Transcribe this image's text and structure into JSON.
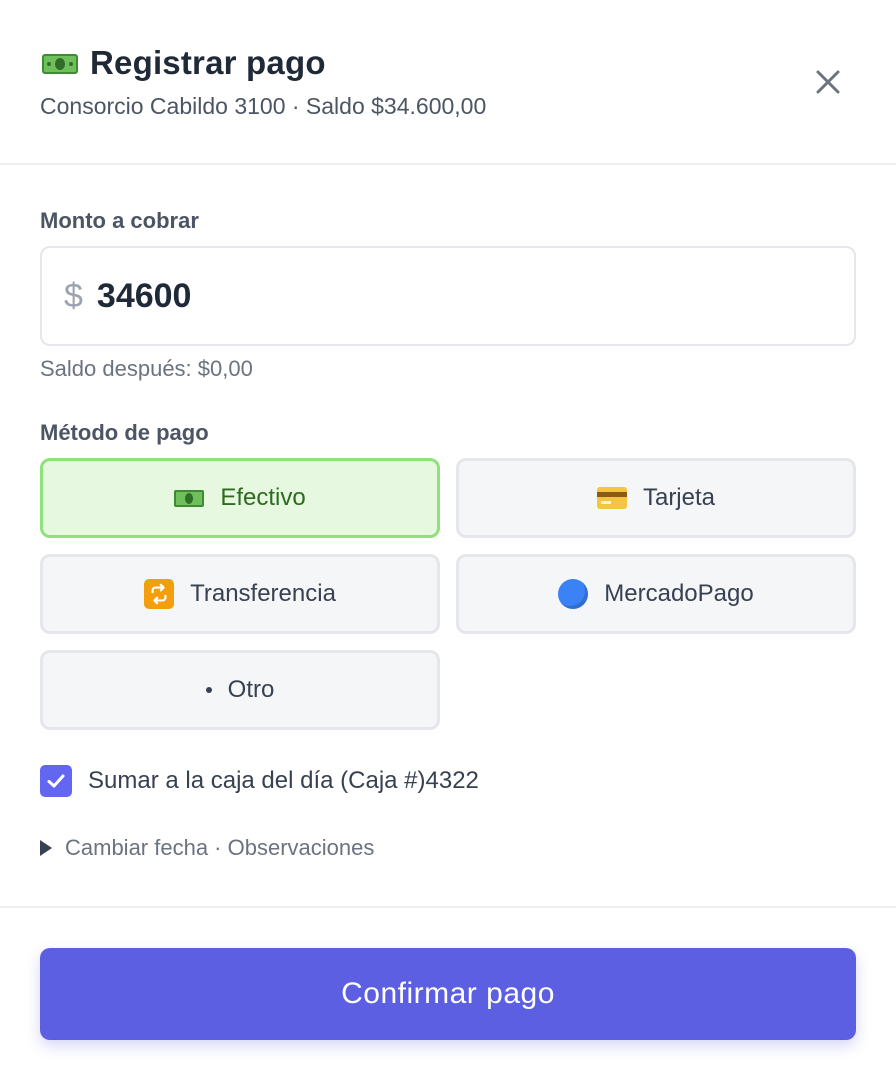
{
  "header": {
    "title": "Registrar pago",
    "title_icon": "dollar-bill-icon",
    "subtitle": "Consorcio Cabildo 3100 · Saldo $34.600,00"
  },
  "amount": {
    "label": "Monto a cobrar",
    "currency_symbol": "$",
    "value": "34600",
    "helper": "Saldo después: $0,00"
  },
  "payment_method": {
    "label": "Método de pago",
    "options": [
      {
        "label": "Efectivo",
        "icon": "dollar-bill-icon",
        "selected": true
      },
      {
        "label": "Tarjeta",
        "icon": "credit-card-icon",
        "selected": false
      },
      {
        "label": "Transferencia",
        "icon": "repeat-icon",
        "selected": false
      },
      {
        "label": "MercadoPago",
        "icon": "blue-circle-icon",
        "selected": false
      },
      {
        "label": "Otro",
        "icon": "dot-icon",
        "selected": false
      }
    ]
  },
  "cash_register": {
    "label": "Sumar a la caja del día (Caja #)4322",
    "checked": true
  },
  "details": {
    "label": "Cambiar fecha · Observaciones"
  },
  "footer": {
    "confirm_label": "Confirmar pago"
  },
  "colors": {
    "accent": "#5d5fe3",
    "checkbox": "#6366f1",
    "selected_bg": "#e6f8e0",
    "selected_border": "#8fe27a",
    "selected_text": "#2f6a1f"
  }
}
